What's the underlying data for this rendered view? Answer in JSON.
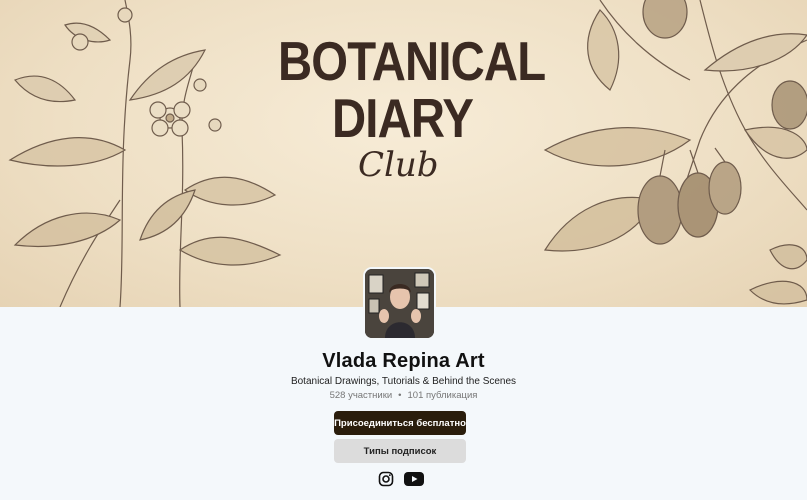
{
  "banner": {
    "title_line1": "BOTANICAL",
    "title_line2": "DIARY",
    "title_line3": "Club"
  },
  "profile": {
    "name": "Vlada Repina Art",
    "tagline": "Botanical Drawings, Tutorials & Behind the Scenes",
    "members": "528 участники",
    "separator": "•",
    "posts": "101 публикация"
  },
  "buttons": {
    "join_label": "Присоединиться бесплатно",
    "tiers_label": "Типы подписок"
  },
  "socials": [
    {
      "icon": "instagram-icon"
    },
    {
      "icon": "youtube-icon"
    }
  ],
  "colors": {
    "banner_bg": "#eedfc4",
    "ink": "#3b2a22",
    "join_button": "#2a1d0c",
    "tiers_button": "#dcdcdc",
    "page_bg": "#f4f8fb"
  }
}
